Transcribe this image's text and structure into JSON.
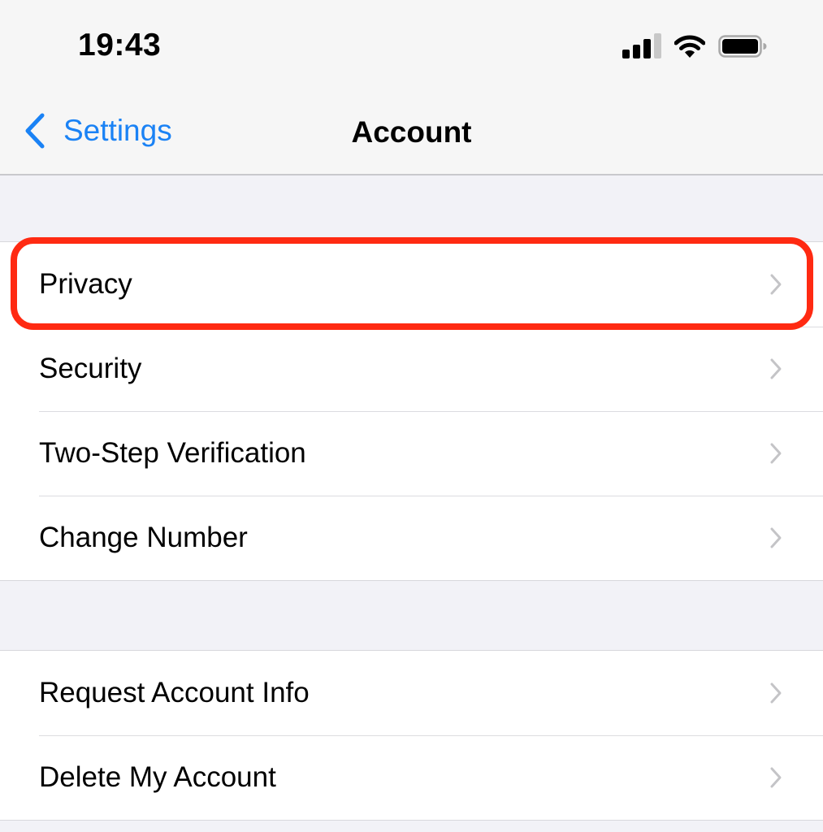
{
  "status_bar": {
    "time": "19:43",
    "signal_bars_active": 3,
    "signal_bars_total": 4,
    "wifi_icon": "wifi-icon",
    "battery_icon": "battery-icon",
    "battery_level_fraction": 1.0
  },
  "nav": {
    "back_label": "Settings",
    "back_icon": "chevron-left-icon",
    "title": "Account",
    "accent_color": "#1a82f5"
  },
  "groups": [
    {
      "items": [
        {
          "label": "Privacy",
          "highlighted": true
        },
        {
          "label": "Security"
        },
        {
          "label": "Two-Step Verification"
        },
        {
          "label": "Change Number"
        }
      ]
    },
    {
      "items": [
        {
          "label": "Request Account Info"
        },
        {
          "label": "Delete My Account"
        }
      ]
    }
  ],
  "highlight_color": "#ff2a12"
}
